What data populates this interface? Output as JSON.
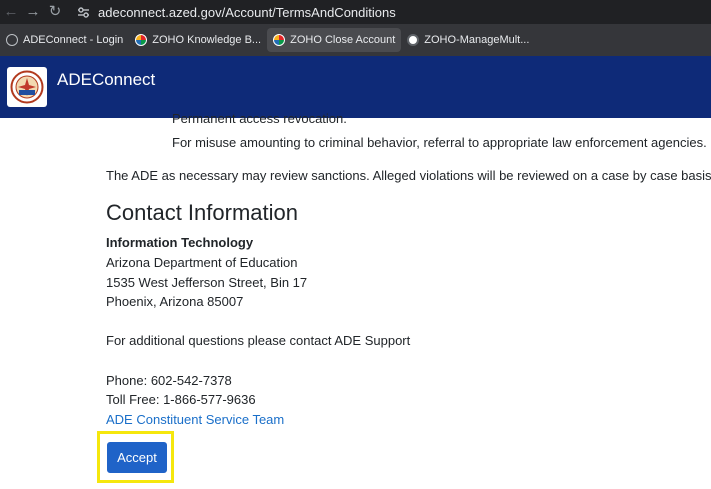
{
  "browser": {
    "url": "adeconnect.azed.gov/Account/TermsAndConditions",
    "bookmarks": [
      {
        "label": "ADEConnect - Login",
        "icon": "globe-icon"
      },
      {
        "label": "ZOHO Knowledge B...",
        "icon": "zoho-icon"
      },
      {
        "label": "ZOHO Close Account",
        "icon": "zoho-icon"
      },
      {
        "label": "ZOHO-ManageMult...",
        "icon": "manage-icon"
      }
    ]
  },
  "header": {
    "title": "ADEConnect",
    "bg_color": "#0e2a78"
  },
  "content": {
    "partial_line": "Permanent access revocation.",
    "bullet_lines": [
      "Permanent access revocation.",
      "For misuse amounting to criminal behavior, referral to appropriate law enforcement agencies."
    ],
    "sanctions_text": "The ADE as necessary may review sanctions. Alleged violations will be reviewed on a case by case basis.",
    "contact_heading": "Contact Information",
    "dept_name": "Information Technology",
    "address_lines": [
      "Arizona Department of Education",
      "1535 West Jefferson Street, Bin 17",
      "Phoenix, Arizona 85007"
    ],
    "support_text": "For additional questions please contact ADE Support",
    "phone": "Phone: 602-542-7378",
    "toll_free": "Toll Free: 1-866-577-9636",
    "service_link": "ADE Constituent Service Team"
  },
  "actions": {
    "accept_label": "Accept",
    "accept_color": "#1f63c8",
    "highlight_color": "#f5e70d"
  }
}
